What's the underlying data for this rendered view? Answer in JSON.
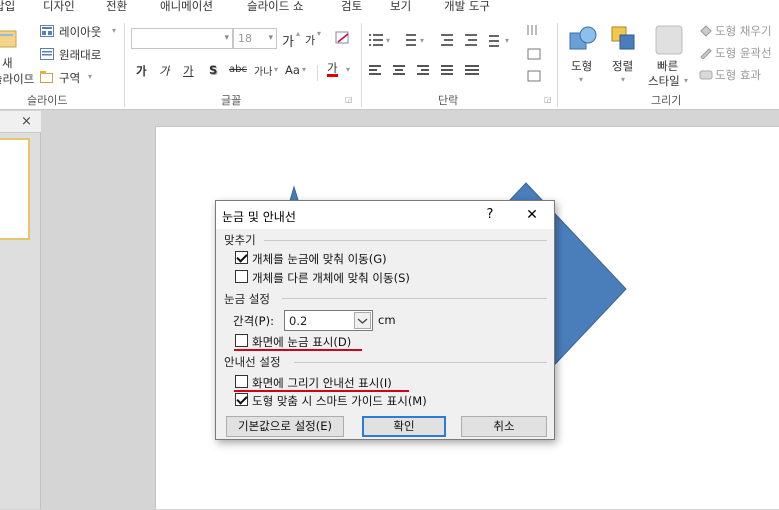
{
  "tabs": [
    "삽입",
    "디자인",
    "전환",
    "애니메이션",
    "슬라이드 쇼",
    "검토",
    "보기",
    "개발 도구"
  ],
  "ribbon": {
    "slides_group": {
      "new_slide_label_1": "새",
      "new_slide_label_2": "슬라이드",
      "layout": "레이아웃",
      "reset": "원래대로",
      "section": "구역",
      "label": "슬라이드"
    },
    "font_group": {
      "font_name": "",
      "font_size": "18",
      "grow": "가",
      "shrink": "가",
      "bold": "가",
      "italic": "가",
      "underline": "가",
      "shadow": "S",
      "strike": "abc",
      "spacing": "가나",
      "case": "Aa",
      "color": "가",
      "label": "글꼴"
    },
    "paragraph_group": {
      "label": "단락"
    },
    "drawing_group": {
      "shapes": "도형",
      "arrange": "정렬",
      "quick_styles_1": "빠른",
      "quick_styles_2": "스타일",
      "shape_fill": "도형 채우기",
      "shape_outline": "도형 윤곽선",
      "shape_effects": "도형 효과",
      "label": "그리기"
    }
  },
  "panel": {
    "close": "×"
  },
  "dialog": {
    "title": "눈금 및 안내선",
    "help": "?",
    "close": "✕",
    "snap_section": "맞추기",
    "snap_grid": "개체를 눈금에 맞춰 이동(G)",
    "snap_grid_checked": true,
    "snap_objects": "개체를 다른 개체에 맞춰 이동(S)",
    "snap_objects_checked": false,
    "grid_section": "눈금 설정",
    "spacing_label": "간격(P):",
    "spacing_value": "0.2",
    "spacing_unit": "cm",
    "display_grid": "화면에 눈금 표시(D)",
    "display_grid_checked": false,
    "guides_section": "안내선 설정",
    "display_guides": "화면에 그리기 안내선 표시(I)",
    "display_guides_checked": false,
    "smart_guides": "도형 맞춤 시 스마트 가이드 표시(M)",
    "smart_guides_checked": true,
    "default_button": "기본값으로 설정(E)",
    "ok_button": "확인",
    "cancel_button": "취소"
  },
  "colors": {
    "shape_fill": "#4a7ebb",
    "shape_stroke": "#3a6396",
    "highlight_underline": "#d0021b",
    "default_button_border": "#2b7cd3"
  }
}
